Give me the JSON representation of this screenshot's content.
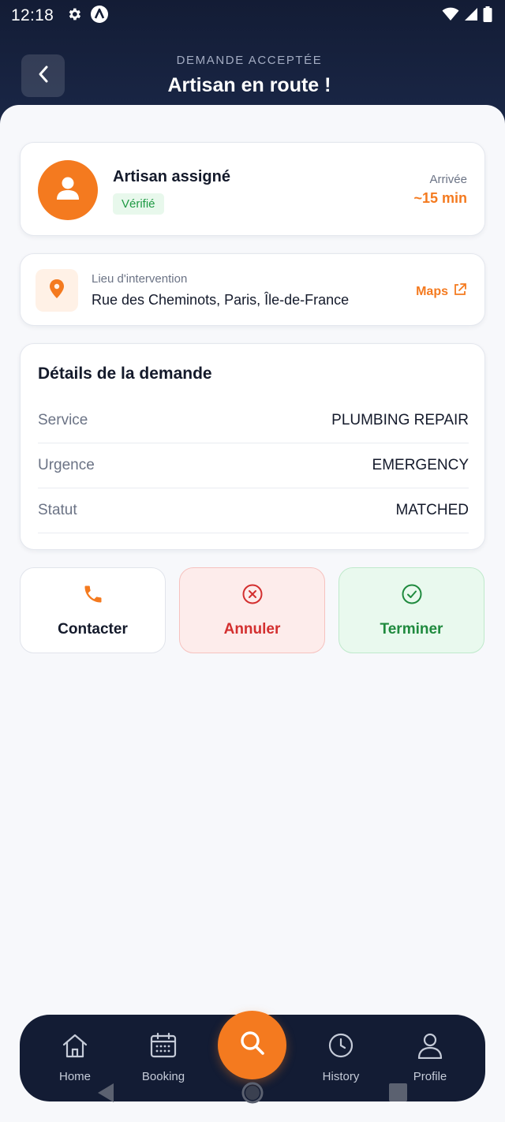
{
  "status_bar": {
    "time": "12:18",
    "icons": [
      "gear-icon",
      "app-logo-icon",
      "wifi-icon",
      "signal-icon",
      "battery-icon"
    ]
  },
  "header": {
    "subtitle": "DEMANDE ACCEPTÉE",
    "title": "Artisan en route !"
  },
  "artisan": {
    "name": "Artisan assigné",
    "badge": "Vérifié",
    "arrival_label": "Arrivée",
    "arrival_value": "~15 min"
  },
  "location": {
    "label": "Lieu d'intervention",
    "address": "Rue des Cheminots, Paris, Île-de-France",
    "maps_label": "Maps"
  },
  "details": {
    "title": "Détails de la demande",
    "rows": [
      {
        "label": "Service",
        "value": "PLUMBING REPAIR"
      },
      {
        "label": "Urgence",
        "value": "EMERGENCY"
      },
      {
        "label": "Statut",
        "value": "MATCHED"
      }
    ]
  },
  "actions": {
    "contact": "Contacter",
    "cancel": "Annuler",
    "finish": "Terminer"
  },
  "bottom_nav": {
    "items": [
      {
        "label": "Home",
        "icon": "home-icon"
      },
      {
        "label": "Booking",
        "icon": "calendar-icon"
      },
      {
        "label": "History",
        "icon": "clock-icon"
      },
      {
        "label": "Profile",
        "icon": "user-icon"
      }
    ],
    "center_icon": "search-icon"
  },
  "colors": {
    "accent": "#f47a1f",
    "header_bg": "#131c35",
    "cancel": "#d32f2f",
    "finish": "#1f8a3e",
    "verified": "#1f9a44"
  }
}
